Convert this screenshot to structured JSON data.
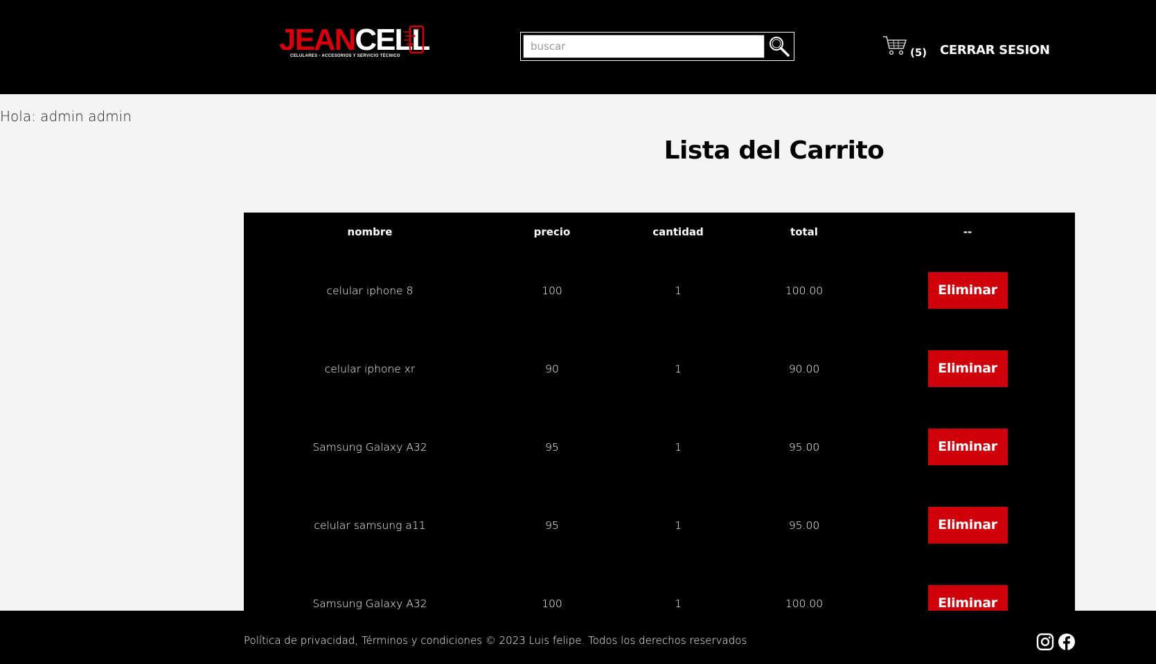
{
  "brand": {
    "name_part1": "JEAN",
    "name_part2": "CELL",
    "tagline": "CELULARES - ACCESORIOS Y SERVICIO TÉCNICO",
    "accent_color": "#d0000a"
  },
  "header": {
    "search_placeholder": "buscar",
    "search_icon": "search-icon",
    "cart_icon": "cart-icon",
    "cart_count": "(5)",
    "logout_label": "CERRAR SESION"
  },
  "main": {
    "greeting": "Hola: admin admin",
    "title": "Lista del Carrito"
  },
  "cart_table": {
    "columns": [
      "nombre",
      "precio",
      "cantidad",
      "total",
      "--"
    ],
    "rows": [
      {
        "nombre": "celular iphone 8",
        "precio": "100",
        "cantidad": "1",
        "total": "100.00",
        "action": "Eliminar"
      },
      {
        "nombre": "celular iphone xr",
        "precio": "90",
        "cantidad": "1",
        "total": "90.00",
        "action": "Eliminar"
      },
      {
        "nombre": "Samsung Galaxy A32",
        "precio": "95",
        "cantidad": "1",
        "total": "95.00",
        "action": "Eliminar"
      },
      {
        "nombre": "celular samsung a11",
        "precio": "95",
        "cantidad": "1",
        "total": "95.00",
        "action": "Eliminar"
      },
      {
        "nombre": "Samsung Galaxy A32",
        "precio": "100",
        "cantidad": "1",
        "total": "100.00",
        "action": "Eliminar"
      }
    ]
  },
  "footer": {
    "text": "Política de privacidad, Términos y condiciones © 2023 Luis felipe. Todos los derechos reservados",
    "social": [
      "instagram-icon",
      "facebook-icon"
    ]
  }
}
